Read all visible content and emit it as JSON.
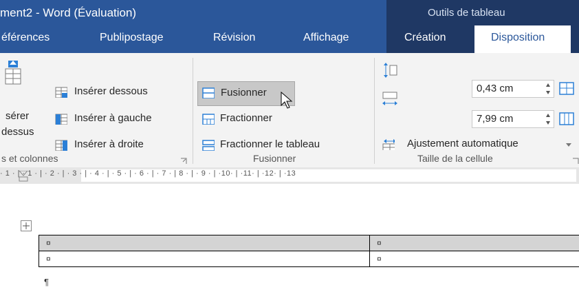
{
  "titlebar": {
    "title": "ment2 - Word (Évaluation)",
    "contextual_group": "Outils de tableau"
  },
  "tabs": [
    {
      "label": "éférences"
    },
    {
      "label": "Publipostage"
    },
    {
      "label": "Révision"
    },
    {
      "label": "Affichage"
    },
    {
      "label": "Création"
    },
    {
      "label": "Disposition",
      "active": true
    }
  ],
  "ribbon": {
    "rows_cols": {
      "insert_above_line1": "sérer",
      "insert_above_line2": "dessus",
      "insert_below": "Insérer dessous",
      "insert_left": "Insérer à gauche",
      "insert_right": "Insérer à droite",
      "group_label": "s et colonnes"
    },
    "merge": {
      "merge_cells": "Fusionner",
      "split_cells": "Fractionner",
      "split_table": "Fractionner le tableau",
      "group_label": "Fusionner"
    },
    "cell_size": {
      "height_value": "0,43 cm",
      "width_value": "7,99 cm",
      "autofit": "Ajustement automatique",
      "group_label": "Taille de la cellule"
    }
  },
  "ruler": {
    "text": "· 1 · | · 1 · | · 2 · | · 3 · | · 4 · | · 5 · | · 6 · | · 7 · | 8 · | · 9 · | ·10· | ·11· | ·12· | ·13"
  },
  "document": {
    "table": [
      [
        "¤",
        "¤"
      ],
      [
        "¤",
        "¤"
      ]
    ],
    "paragraph_mark": "¶"
  },
  "colors": {
    "titlebar": "#2b579a",
    "contextual": "#1f3864",
    "ribbon": "#f3f3f3",
    "highlight": "#c8c8c8"
  }
}
